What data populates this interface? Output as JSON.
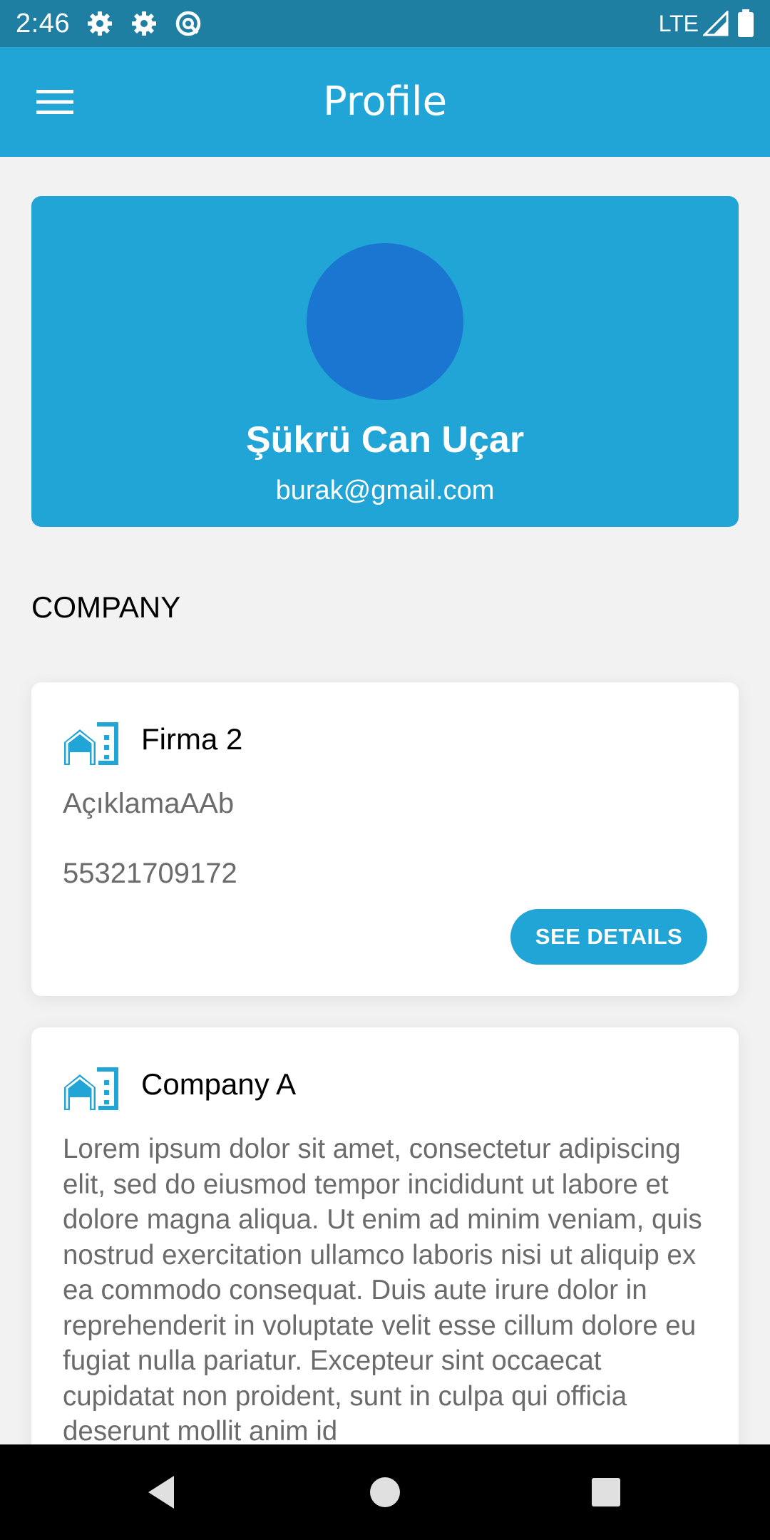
{
  "status_bar": {
    "time": "2:46",
    "icons": [
      "gear-icon",
      "gear-icon",
      "data-saver-icon"
    ],
    "network": "LTE",
    "right_icons": [
      "signal-icon",
      "battery-icon"
    ]
  },
  "app_bar": {
    "title": "Profile",
    "menu_icon": "hamburger-menu-icon"
  },
  "profile": {
    "name": "Şükrü Can Uçar",
    "email": "burak@gmail.com"
  },
  "section_title": "COMPANY",
  "companies": [
    {
      "name": "Firma 2",
      "description": "AçıklamaAAb",
      "phone": "55321709172",
      "button_label": "SEE DETAILS"
    },
    {
      "name": "Company A",
      "description": "Lorem ipsum dolor sit amet, consectetur adipiscing elit, sed do eiusmod tempor incididunt ut labore et dolore magna aliqua. Ut enim ad minim veniam, quis nostrud exercitation ullamco laboris nisi ut aliquip ex ea commodo consequat. Duis aute irure dolor in reprehenderit in voluptate velit esse cillum dolore eu fugiat nulla pariatur. Excepteur sint occaecat cupidatat non proident, sunt in culpa qui officia deserunt mollit anim id"
    }
  ],
  "colors": {
    "status_bar": "#1f7fa3",
    "app_bar": "#21a4d6",
    "avatar": "#1b76d2",
    "background": "#f2f2f2",
    "secondary_text": "#6b6b6b"
  },
  "nav_bar": {
    "buttons": [
      "back-icon",
      "home-icon",
      "recents-icon"
    ]
  }
}
